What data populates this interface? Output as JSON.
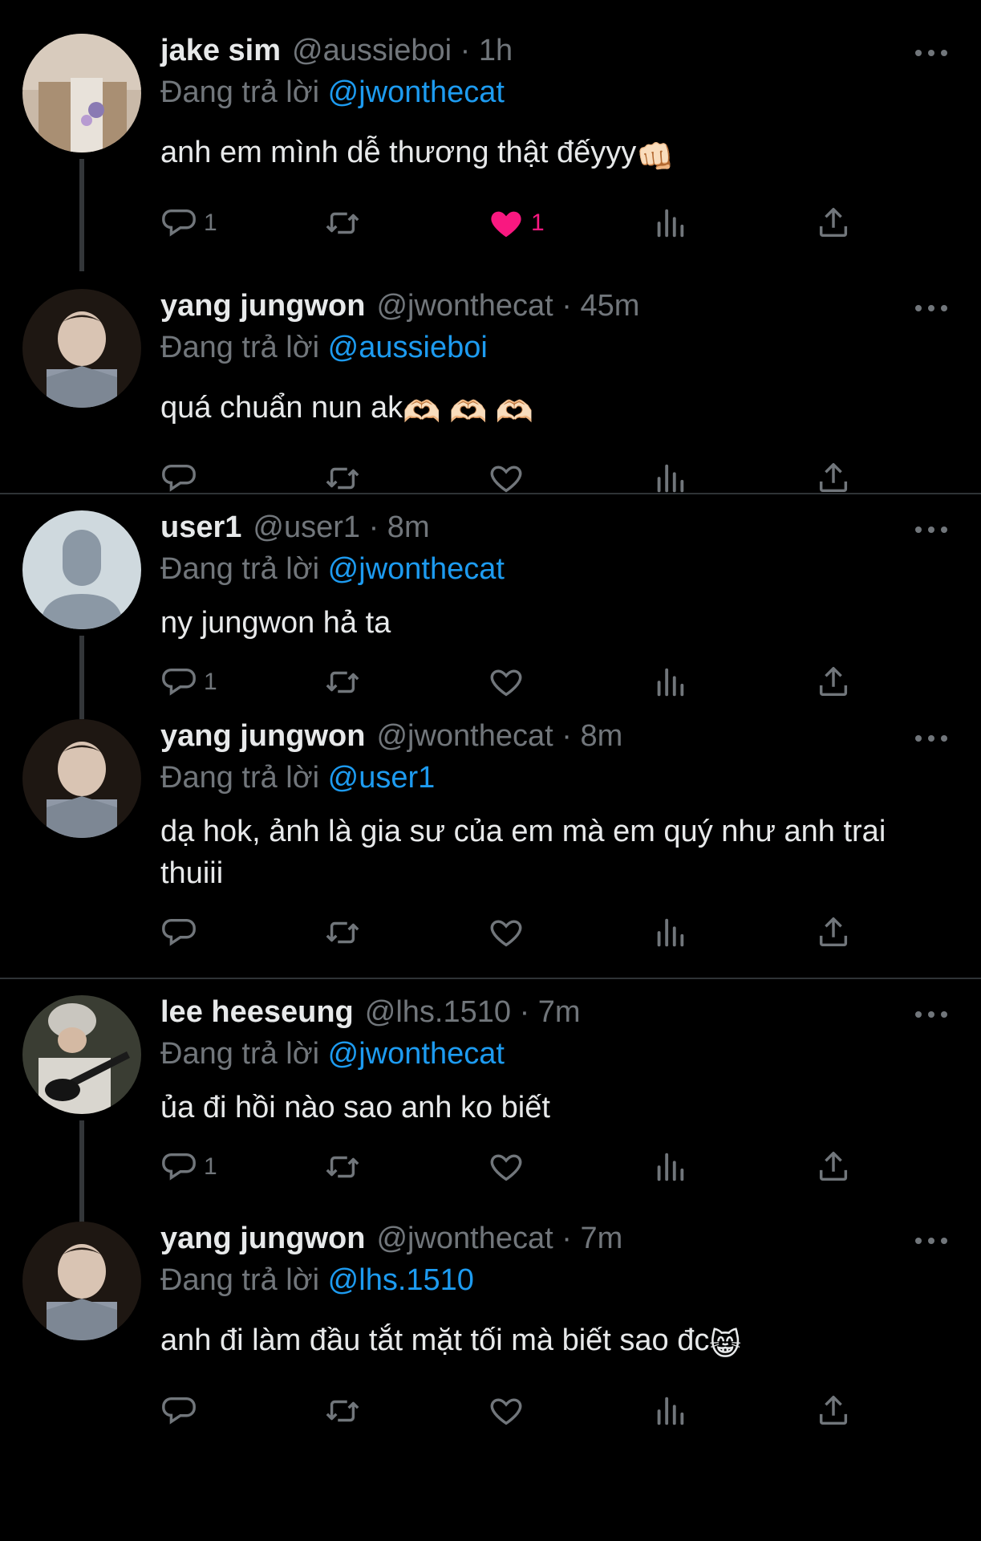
{
  "colors": {
    "background": "#000000",
    "text": "#e7e9ea",
    "muted": "#71767b",
    "link": "#1d9bf0",
    "like_active": "#f91880",
    "divider": "#2f3336"
  },
  "icons": {
    "reply": "reply-icon",
    "retweet": "retweet-icon",
    "like": "heart-icon",
    "views": "views-icon",
    "share": "share-icon",
    "more": "more-icon"
  },
  "tweets": [
    {
      "name": "jake sim",
      "meta": "@aussieboi · 1h",
      "replying_prefix": "Đang trả lời",
      "replying_to": "@jwonthecat",
      "text": "anh em mình dễ thương thật đếyyy",
      "emoji": "👊🏻",
      "reply_count": "1",
      "like_count": "1",
      "liked": true
    },
    {
      "name": "yang jungwon",
      "meta": "@jwonthecat · 45m",
      "replying_prefix": "Đang trả lời",
      "replying_to": "@aussieboi",
      "text": "quá chuẩn nun ak",
      "emoji": "🫶🏻 🫶🏻 🫶🏻",
      "reply_count": "",
      "like_count": "",
      "liked": false
    },
    {
      "name": "user1",
      "meta": "@user1 · 8m",
      "replying_prefix": "Đang trả lời",
      "replying_to": "@jwonthecat",
      "text": "ny jungwon hả ta",
      "emoji": "",
      "reply_count": "1",
      "like_count": "",
      "liked": false
    },
    {
      "name": "yang jungwon",
      "meta": "@jwonthecat · 8m",
      "replying_prefix": "Đang trả lời",
      "replying_to": "@user1",
      "text": "dạ hok, ảnh là gia sư của em mà em quý như anh trai thuiii",
      "emoji": "",
      "reply_count": "",
      "like_count": "",
      "liked": false
    },
    {
      "name": "lee heeseung",
      "meta": "@lhs.1510 · 7m",
      "replying_prefix": "Đang trả lời",
      "replying_to": "@jwonthecat",
      "text": "ủa đi hồi nào sao anh ko biết",
      "emoji": "",
      "reply_count": "1",
      "like_count": "",
      "liked": false
    },
    {
      "name": "yang jungwon",
      "meta": "@jwonthecat · 7m",
      "replying_prefix": "Đang trả lời",
      "replying_to": "@lhs.1510",
      "text": "anh đi làm đầu tắt mặt tối mà biết sao đc",
      "emoji": "😸",
      "reply_count": "",
      "like_count": "",
      "liked": false
    }
  ]
}
